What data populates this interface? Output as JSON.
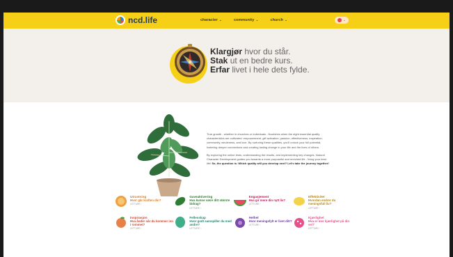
{
  "header": {
    "logo_text": "ncd.life",
    "nav": [
      {
        "label": "character"
      },
      {
        "label": "community"
      },
      {
        "label": "church"
      }
    ]
  },
  "hero": {
    "line1_bold": "Klargjør",
    "line1_rest": " hvor du står.",
    "line2_bold": "Stak",
    "line2_rest": " ut en bedre kurs.",
    "line3_bold": "Erfar",
    "line3_rest": " livet i hele dets fylde."
  },
  "about": {
    "p1": "True growth - whether in churches or individuals - flourishes when the eight essential quality characteristics are cultivated: empowerment, gift activation, passion, effectiveness, inspiration, community, wholeness, and love. By nurturing these qualities, you'll unlock your full potential, fostering deeper connections and creating lasting change in your life and the lives of others.",
    "p2_start": "By exploring the online tests, understanding the results, and implementing key changes, Natural Character Development guides you towards a more purposeful and enriched life - living your best life! ",
    "p2_bold": "So, the question is: Which quality will you develop next? Let's take the journey together!"
  },
  "qualities": [
    {
      "title": "Utrustning",
      "question": "Hvor går kraften din?",
      "link": "LETTURE ›",
      "color": "#e07b1a"
    },
    {
      "title": "Gaveaktivering",
      "question": "Hva kunne være ditt største bidrag?",
      "link": "LETTURE ›",
      "color": "#2f7d32"
    },
    {
      "title": "Engasjement",
      "question": "Hva gir mere din nytt liv?",
      "link": "LETTURE ›",
      "color": "#c2185b"
    },
    {
      "title": "Effektivitet",
      "question": "Hvordan endrer du meningsfull liv?",
      "link": "LETTURE ›",
      "color": "#b8860b"
    },
    {
      "title": "Inspirasjon",
      "question": "Hva ånder når du kommer inn i rommet?",
      "link": "LETTURE ›",
      "color": "#d8432a"
    },
    {
      "title": "Fellesskap",
      "question": "Hvor godt samspiller du med andre?",
      "link": "LETTURE ›",
      "color": "#1f8a6e"
    },
    {
      "title": "Helhet",
      "question": "Hvor meningsfylt er livet ditt?",
      "link": "LETTURE ›",
      "color": "#6a3fa0"
    },
    {
      "title": "Kjærlighet",
      "question": "Hva er mer kjærlighet på din vei?",
      "link": "LETTURE ›",
      "color": "#e7508a"
    }
  ],
  "colors": {
    "header": "#f6cf17",
    "hero_bg": "#f3f0eb",
    "brand": "#1f3b63"
  }
}
